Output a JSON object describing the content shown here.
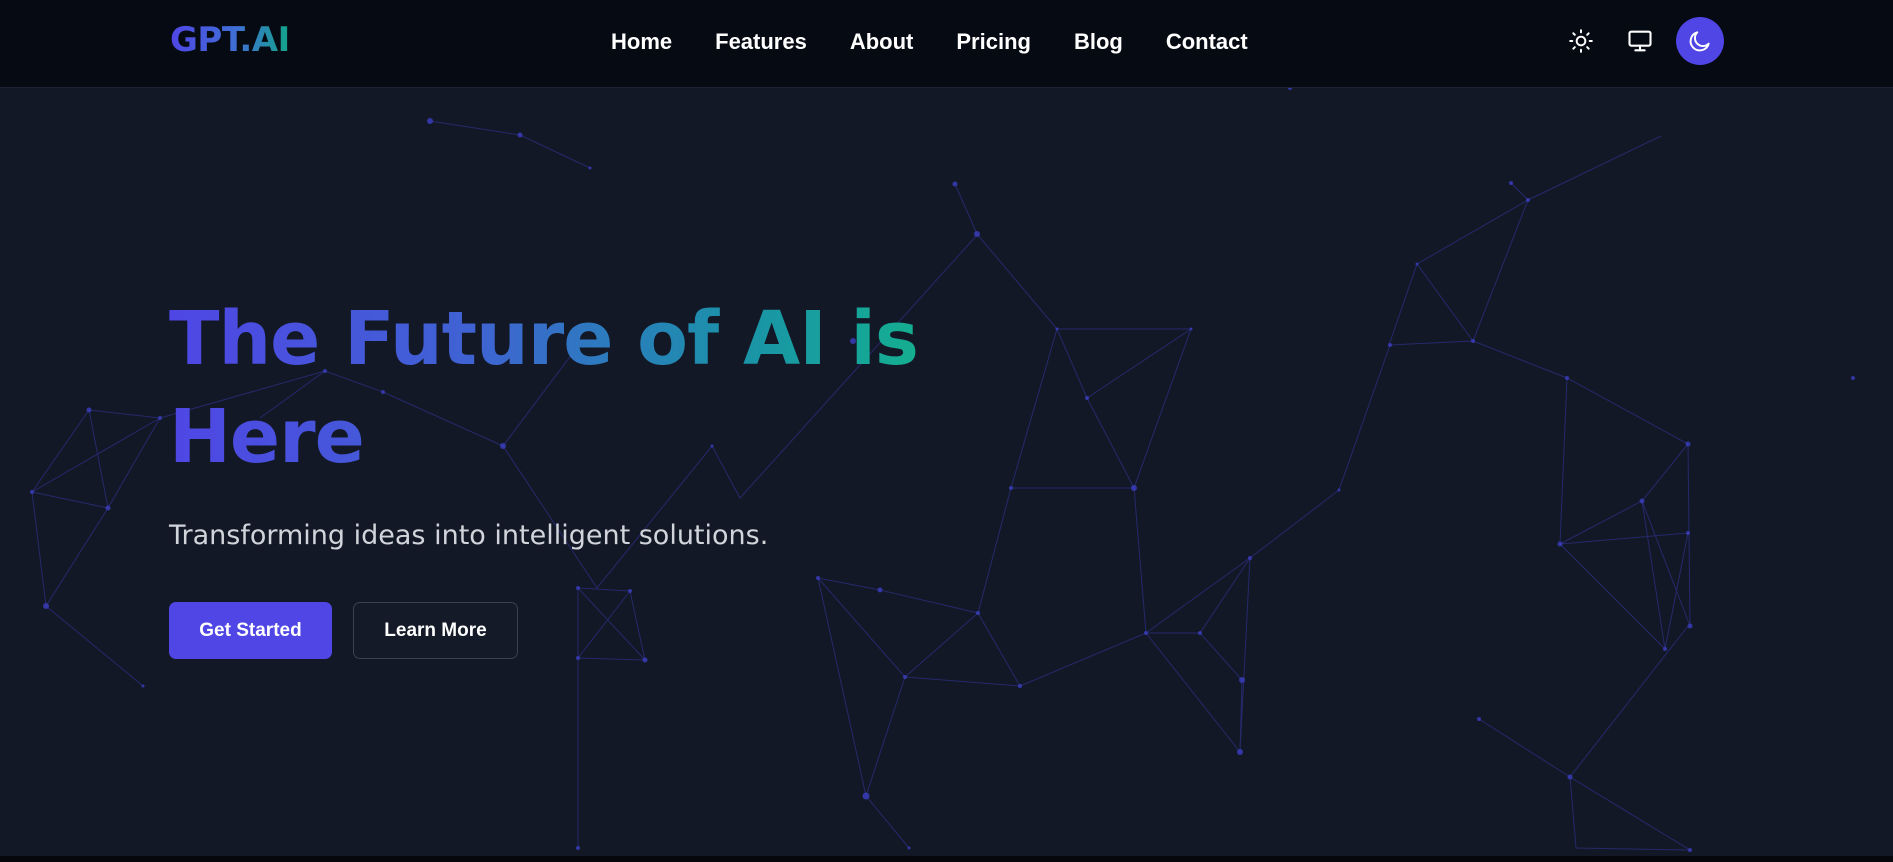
{
  "brand": {
    "logo_text": "GPT.AI"
  },
  "nav": {
    "links": [
      "Home",
      "Features",
      "About",
      "Pricing",
      "Blog",
      "Contact"
    ]
  },
  "theme_controls": {
    "items": [
      {
        "icon": "sun-icon",
        "label": "Light theme"
      },
      {
        "icon": "monitor-icon",
        "label": "System theme"
      },
      {
        "icon": "moon-icon",
        "label": "Dark theme",
        "active": true
      }
    ],
    "active_color": "#4f46e5"
  },
  "hero": {
    "title": "The Future of AI is Here",
    "subtitle": "Transforming ideas into intelligent solutions.",
    "primary_button": "Get Started",
    "secondary_button": "Learn More"
  },
  "colors": {
    "background": "#131826",
    "navbar": "#060a13",
    "accent": "#4f46e5",
    "gradient_end": "#14b08f",
    "network": "#3b3fbf"
  }
}
